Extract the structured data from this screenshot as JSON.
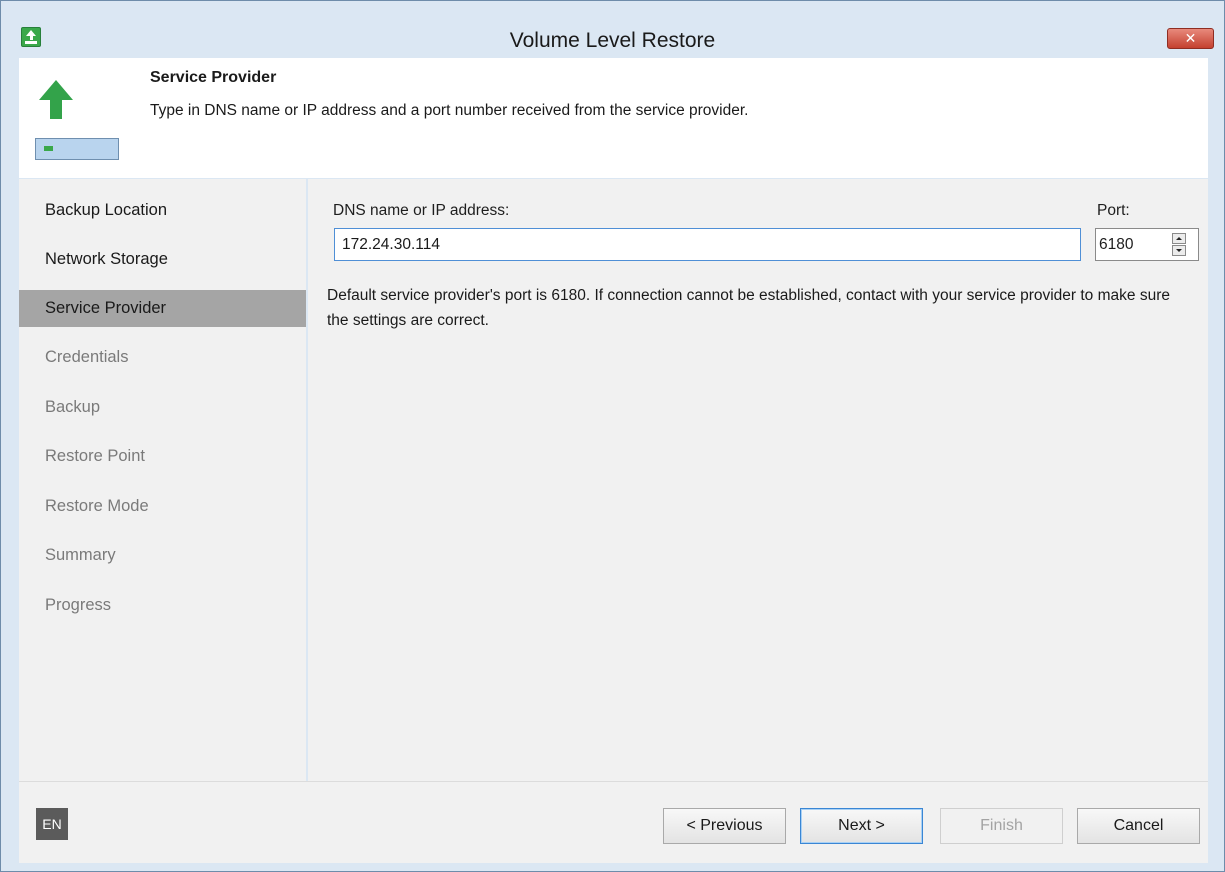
{
  "window": {
    "title": "Volume Level Restore",
    "close_label": "✕",
    "accent_color": "#33a34a",
    "close_color": "#c4402f"
  },
  "header": {
    "title": "Service Provider",
    "description": "Type in DNS name or IP address and a port number received from the service provider."
  },
  "sidebar": {
    "items": [
      {
        "label": "Backup Location",
        "state": "completed"
      },
      {
        "label": "Network Storage",
        "state": "completed"
      },
      {
        "label": "Service Provider",
        "state": "active"
      },
      {
        "label": "Credentials",
        "state": "disabled"
      },
      {
        "label": "Backup",
        "state": "disabled"
      },
      {
        "label": "Restore Point",
        "state": "disabled"
      },
      {
        "label": "Restore Mode",
        "state": "disabled"
      },
      {
        "label": "Summary",
        "state": "disabled"
      },
      {
        "label": "Progress",
        "state": "disabled"
      }
    ]
  },
  "form": {
    "dns_label": "DNS name or IP address:",
    "dns_value": "172.24.30.114",
    "port_label": "Port:",
    "port_value": "6180",
    "hint": "Default service provider's port is 6180. If connection cannot be established, contact with your service provider to make sure the settings are correct."
  },
  "footer": {
    "language": "EN",
    "previous_label": "< Previous",
    "next_label": "Next >",
    "finish_label": "Finish",
    "cancel_label": "Cancel"
  }
}
